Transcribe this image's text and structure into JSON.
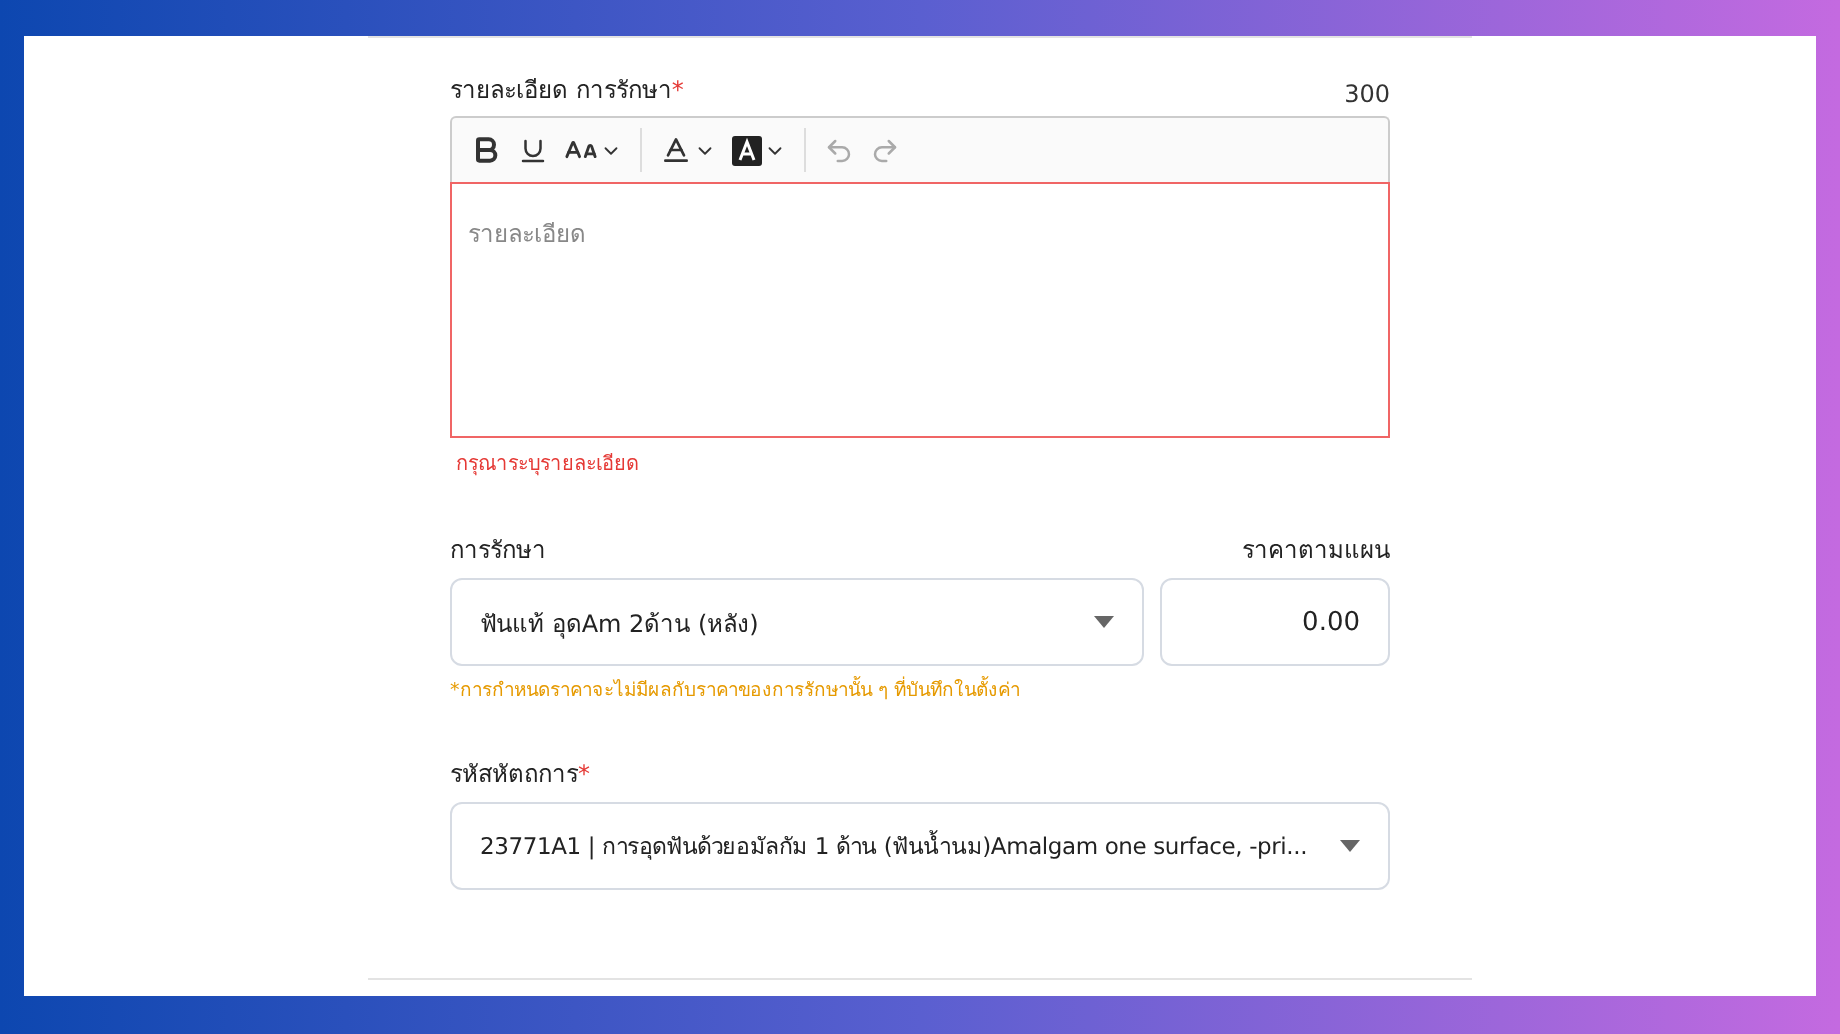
{
  "details": {
    "label": "รายละเอียด การรักษา",
    "required_mark": "*",
    "counter": "300",
    "placeholder": "รายละเอียด",
    "error": "กรุณาระบุรายละเอียด"
  },
  "treatment": {
    "label": "การรักษา",
    "value": "ฟันแท้ อุดAm 2ด้าน (หลัง)"
  },
  "price": {
    "label": "ราคาตามแผน",
    "value": "0.00"
  },
  "note": "*การกำหนดราคาจะไม่มีผลกับราคาของการรักษานั้น ๆ ที่บันทึกในตั้งค่า",
  "code": {
    "label": "รหัสหัตถการ",
    "required_mark": "*",
    "value": "23771A1 | การอุดฟันด้วยอมัลกัม 1 ด้าน (ฟันน้ำนม)Amalgam one surface, -pri..."
  }
}
